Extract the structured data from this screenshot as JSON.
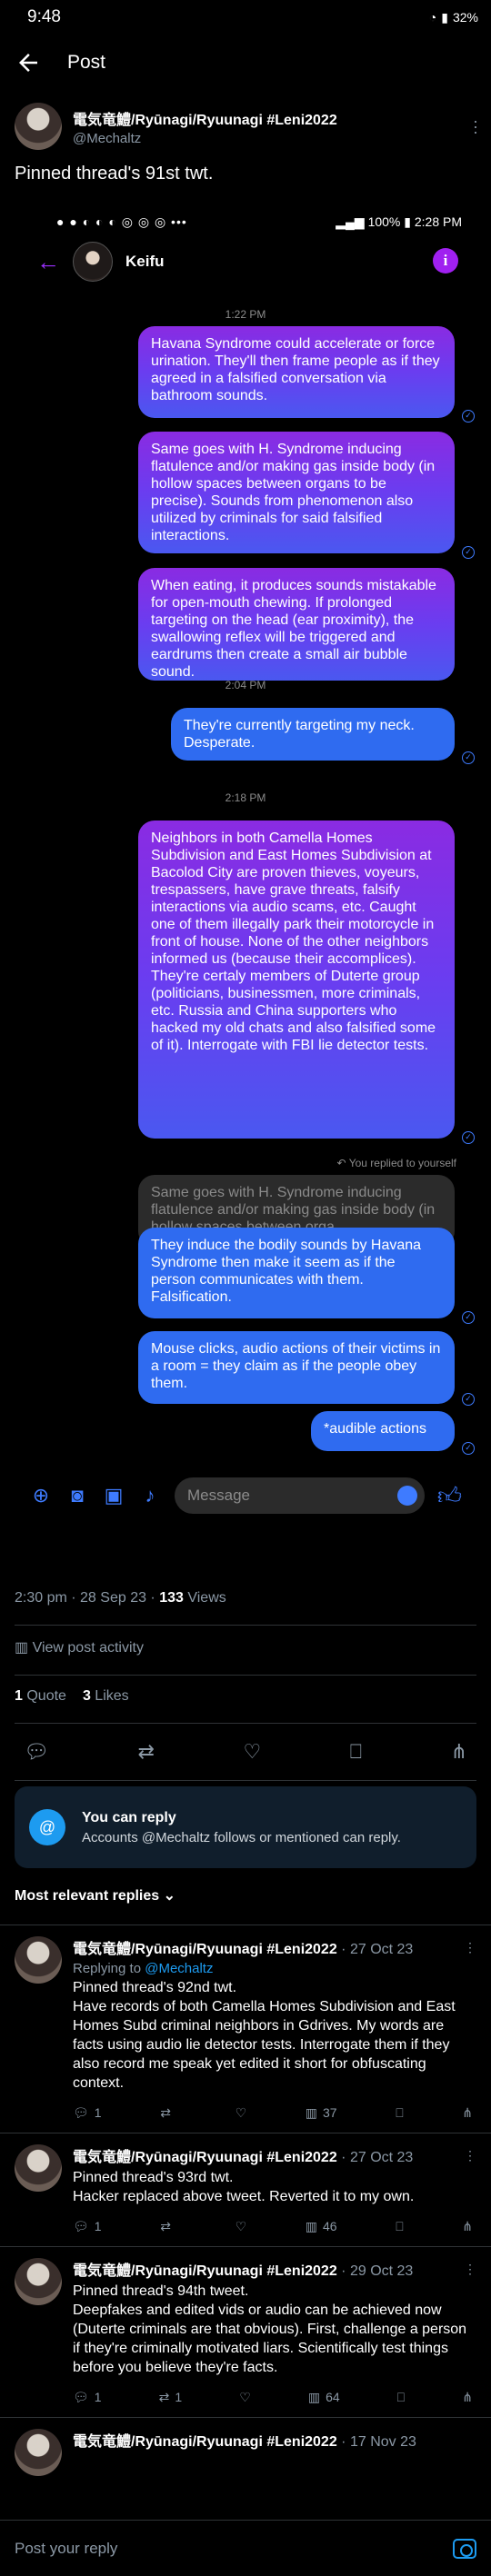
{
  "status_bar": {
    "time": "9:48",
    "battery": "32%"
  },
  "header": {
    "title": "Post"
  },
  "author": {
    "display_name": "電気竜鱧/Ryūnagi/Ryuunagi #Leni2022",
    "handle": "@Mechaltz"
  },
  "tweet_text": "Pinned thread's 91st twt.",
  "screenshot": {
    "status": {
      "battery": "100%",
      "time": "2:28 PM"
    },
    "contact_name": "Keifu",
    "times": [
      "1:22 PM",
      "2:04 PM",
      "2:18 PM"
    ],
    "messages": [
      "Havana Syndrome could accelerate or force urination. They'll then frame people as if they agreed in a falsified conversation via bathroom sounds.",
      "Same goes with H. Syndrome inducing flatulence and/or making gas inside body (in hollow spaces between organs to be precise). Sounds from phenomenon also utilized by criminals for said falsified interactions.",
      "When eating, it produces sounds mistakable for open-mouth chewing. If prolonged targeting on the head (ear proximity), the swallowing reflex will be triggered and eardrums then create a small air bubble sound.",
      "They're currently targeting my neck. Desperate.",
      "Neighbors in both Camella Homes Subdivision and East Homes Subdivision at Bacolod City are proven thieves, voyeurs, trespassers, have grave threats, falsify interactions via audio scams, etc. Caught one of them illegally park their motorcycle in front of house. None of the other neighbors informed us (because their accomplices). They're certaly members of Duterte group (politicians, businessmen, more criminals, etc. Russia and China supporters who hacked my old chats and also falsified some of it). Interrogate with FBI lie detector tests.",
      "They induce the bodily sounds by Havana Syndrome then make it seem as if the person communicates with them. Falsification.",
      "Mouse clicks, audio actions of their victims in a room = they claim as if the people obey them.",
      "*audible actions"
    ],
    "replied_label": "You replied to yourself",
    "quoted_reply": "Same goes with H. Syndrome inducing flatulence and/or making gas inside body (in hollow spaces between orga...",
    "composer_placeholder": "Message"
  },
  "meta": {
    "timestamp": "2:30 pm · 28 Sep 23 · ",
    "views_count": "133",
    "views_label": " Views"
  },
  "activity_label": "View post activity",
  "counts": {
    "quotes": "1",
    "quotes_label": " Quote",
    "likes": "3",
    "likes_label": " Likes"
  },
  "can_reply": {
    "title": "You can reply",
    "text": "Accounts @Mechaltz follows or mentioned can reply."
  },
  "sort_label": "Most relevant replies",
  "replies": [
    {
      "name": "電気竜鱧/Ryūnagi/Ryuunagi #Leni2022",
      "date": " · 27 Oct 23",
      "replying_prefix": "Replying to ",
      "replying_to": "@Mechaltz",
      "text": "Pinned thread's 92nd twt.\nHave records of both Camella Homes Subdivision and East Homes Subd criminal neighbors in Gdrives. My words are facts using audio lie detector tests. Interrogate them if they also record me speak yet edited it short for obfuscating context.",
      "replies": "1",
      "retweets": "",
      "views": "37"
    },
    {
      "name": "電気竜鱧/Ryūnagi/Ryuunagi #Leni2022",
      "date": " · 27 Oct 23",
      "text": "Pinned thread's 93rd twt.\nHacker replaced above tweet. Reverted it to my own.",
      "replies": "1",
      "retweets": "",
      "views": "46"
    },
    {
      "name": "電気竜鱧/Ryūnagi/Ryuunagi #Leni2022",
      "date": " · 29 Oct 23",
      "text": "Pinned thread's 94th tweet.\nDeepfakes and edited vids or audio can be achieved now (Duterte criminals are that obvious). First, challenge a person if they're criminally motivated liars. Scientifically test things before you believe they're facts.",
      "replies": "1",
      "retweets": "1",
      "views": "64"
    },
    {
      "name": "電気竜鱧/Ryūnagi/Ryuunagi #Leni2022",
      "date": " · 17 Nov 23"
    }
  ],
  "bottom": {
    "placeholder": "Post your reply"
  }
}
